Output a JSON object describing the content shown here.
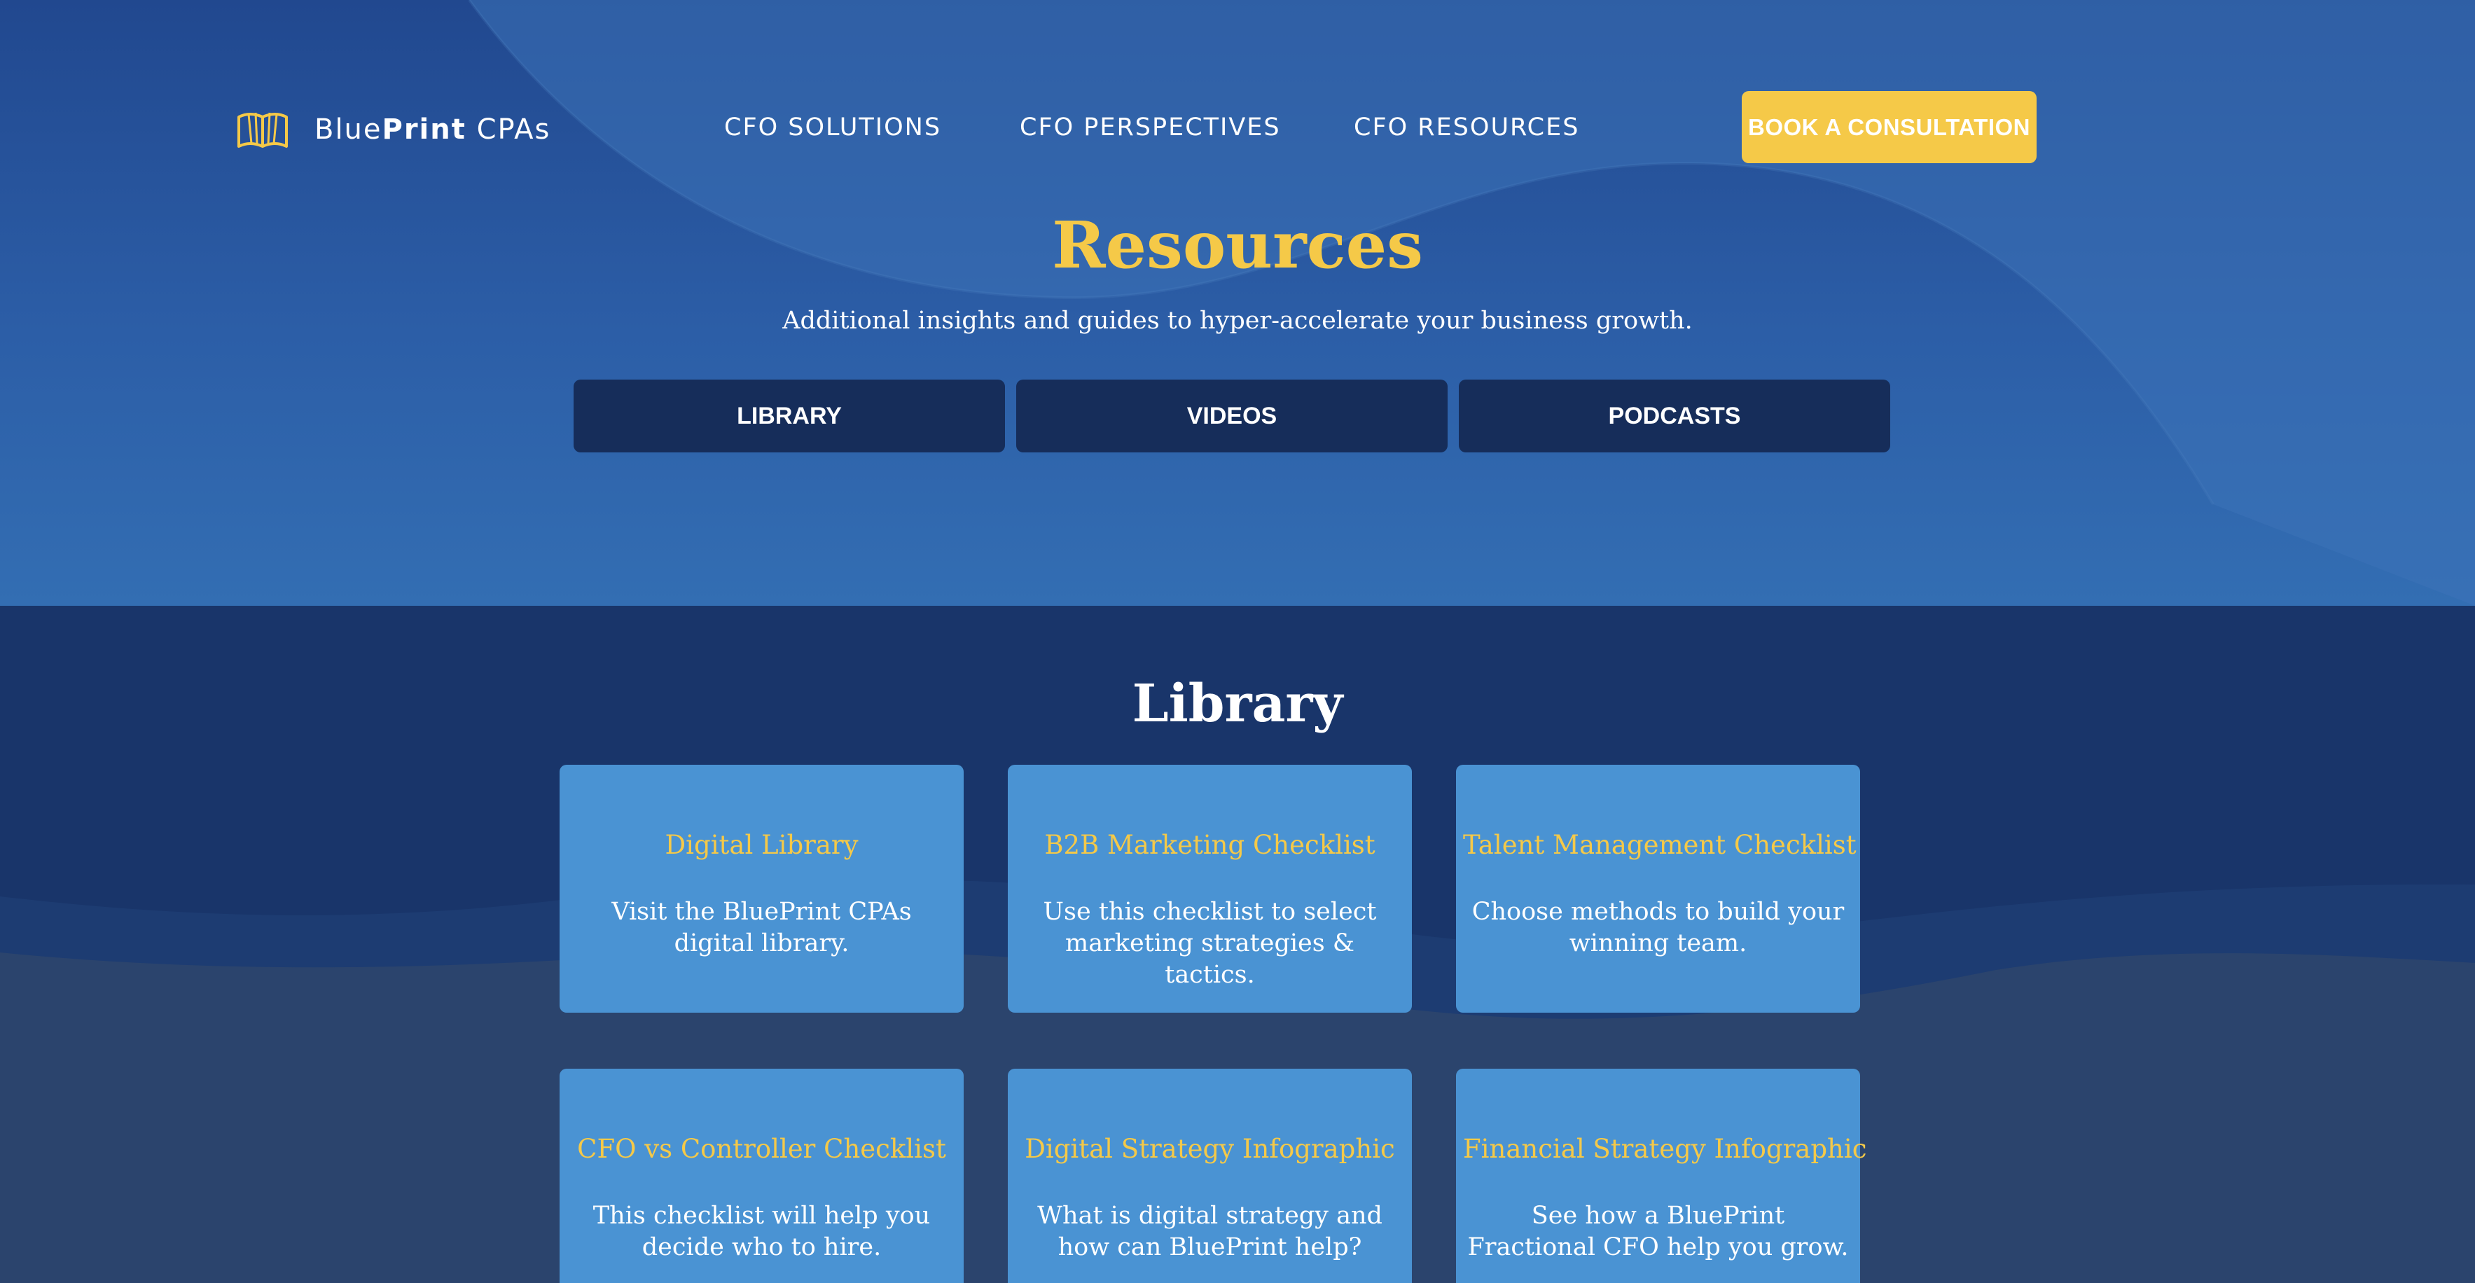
{
  "header": {
    "logo": {
      "text_light": "Blue",
      "text_bold": "Print",
      "text_suffix": " CPAs",
      "icon": "book-icon"
    },
    "nav": [
      {
        "label": "CFO SOLUTIONS"
      },
      {
        "label": "CFO PERSPECTIVES"
      },
      {
        "label": "CFO RESOURCES"
      }
    ],
    "cta_label": "BOOK A CONSULTATION"
  },
  "hero": {
    "title": "Resources",
    "subtitle": "Additional insights and guides to hyper-accelerate your business growth.",
    "tabs": [
      {
        "label": "LIBRARY"
      },
      {
        "label": "VIDEOS"
      },
      {
        "label": "PODCASTS"
      }
    ]
  },
  "library": {
    "title": "Library",
    "cards": [
      {
        "title": "Digital Library",
        "desc_line1": "Visit the BluePrint CPAs",
        "desc_line2": "digital library."
      },
      {
        "title": "B2B Marketing Checklist",
        "desc_line1": "Use this checklist to select",
        "desc_line2": "marketing strategies & tactics."
      },
      {
        "title": "Talent Management Checklist",
        "desc_line1": "Choose methods to build your",
        "desc_line2": "winning team."
      },
      {
        "title": "CFO vs Controller Checklist",
        "desc_line1": "This checklist will help you",
        "desc_line2": "decide who to hire."
      },
      {
        "title": "Digital Strategy Infographic",
        "desc_line1": "What is digital strategy and",
        "desc_line2": "how can BluePrint help?"
      },
      {
        "title": "Financial Strategy Infographic",
        "desc_line1": "See how a BluePrint",
        "desc_line2": "Fractional CFO help you grow."
      }
    ]
  },
  "colors": {
    "accent_yellow": "#f5c948",
    "hero_blue": "#2c5ea7",
    "tab_navy": "#162d5a",
    "section_navy": "#19356a",
    "card_blue": "#4a93d3"
  }
}
